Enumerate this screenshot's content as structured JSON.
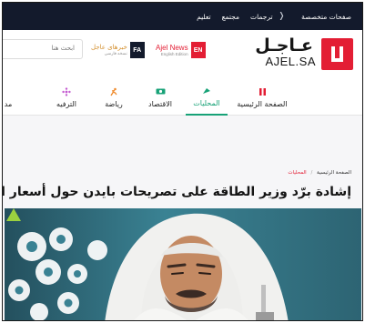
{
  "topbar": {
    "links": [
      "صفحات متخصصة",
      "ترجمات",
      "مجتمع",
      "تعليم"
    ],
    "separator_icon": "chevron-left-icon"
  },
  "header": {
    "logo_ar": "عـاجـل",
    "logo_en": "AJEL.SA",
    "editions": [
      {
        "badge": "EN",
        "title": "Ajel News",
        "subtitle": "English Edition",
        "color": "#e31e34"
      },
      {
        "badge": "FA",
        "title": "خبرهای عاجل",
        "subtitle": "نسخه فارسی",
        "color": "#131a2c"
      }
    ],
    "search_placeholder": "ابحث هنا"
  },
  "nav": {
    "items": [
      {
        "label": "الصفحة الرئيسية",
        "icon": "home-icon",
        "active": false,
        "color": "#e31e34"
      },
      {
        "label": "المحليات",
        "icon": "local-icon",
        "active": true,
        "color": "#17a277"
      },
      {
        "label": "الاقتصاد",
        "icon": "money-icon",
        "active": false,
        "color": "#17a277"
      },
      {
        "label": "رياضة",
        "icon": "sport-icon",
        "active": false,
        "color": "#ef8a2b"
      },
      {
        "label": "الترفيه",
        "icon": "entertainment-icon",
        "active": false,
        "color": "#c45bd0"
      },
      {
        "label": "مد",
        "icon": "",
        "active": false,
        "color": "#222222"
      }
    ]
  },
  "breadcrumb": {
    "home": "الصفحة الرئيسية",
    "separator": "/",
    "current": "المحليات"
  },
  "article": {
    "title": "إشادة برّد وزير الطاقة على تصريحات بايدن حول أسعار النفط"
  },
  "colors": {
    "brand_red": "#e31e34",
    "navy": "#131a2c",
    "green": "#17a277"
  }
}
